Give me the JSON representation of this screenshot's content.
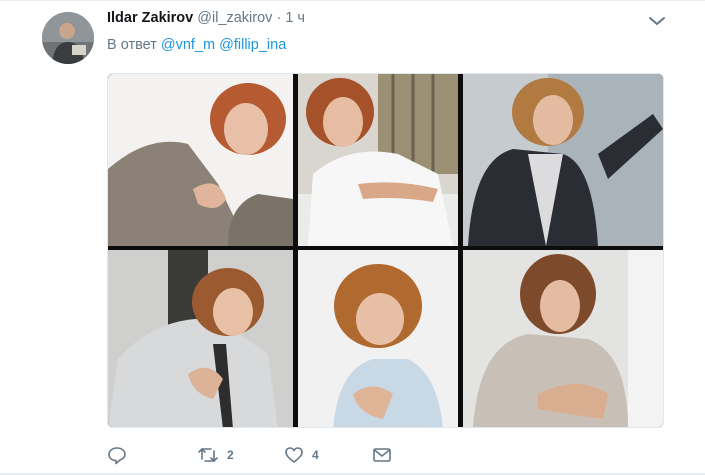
{
  "tweet": {
    "author_name": "Ildar Zakirov",
    "author_handle": "@il_zakirov",
    "separator": "·",
    "time": "1 ч",
    "reply_prefix": "В ответ",
    "mentions": [
      "@vnf_m",
      "@fillip_ina"
    ],
    "media_panels": 6,
    "actions": {
      "reply_count": "",
      "retweet_count": "2",
      "like_count": "4",
      "dm_count": ""
    }
  },
  "colors": {
    "link": "#1b95e0",
    "secondary_text": "#657786",
    "primary_text": "#14171a",
    "border": "#e6ecf0"
  },
  "icons": [
    "caret-down-icon",
    "reply-icon",
    "retweet-icon",
    "heart-icon",
    "envelope-icon"
  ]
}
